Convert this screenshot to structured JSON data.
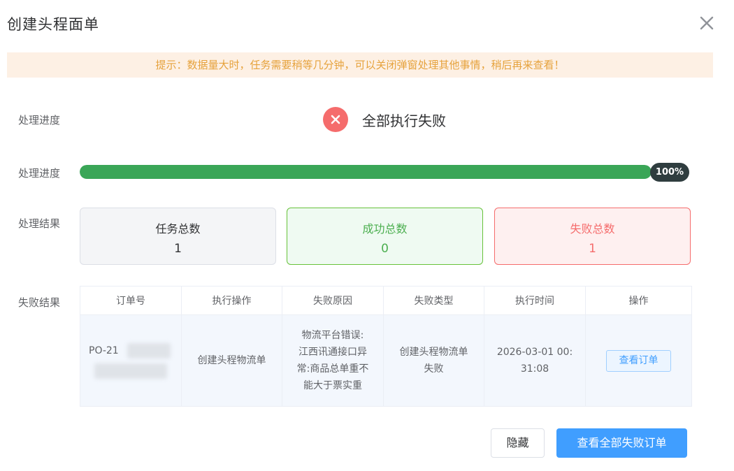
{
  "dialog": {
    "title": "创建头程面单",
    "close_icon": "close-icon"
  },
  "tip": {
    "text": "提示：数据量大时，任务需要稍等几分钟，可以关闭弹窗处理其他事情，稍后再来查看！"
  },
  "status_row": {
    "label": "处理进度",
    "icon": "error-circle-icon",
    "icon_color": "#f56c6c",
    "text": "全部执行失败"
  },
  "progress_row": {
    "label": "处理进度",
    "percent": 100,
    "percent_text": "100%",
    "bar_color": "#3aa657"
  },
  "result_row": {
    "label": "处理结果",
    "cards": [
      {
        "label": "任务总数",
        "value": "1"
      },
      {
        "label": "成功总数",
        "value": "0"
      },
      {
        "label": "失败总数",
        "value": "1"
      }
    ]
  },
  "fail_row": {
    "label": "失败结果",
    "columns": [
      "订单号",
      "执行操作",
      "失败原因",
      "失败类型",
      "执行时间",
      "操作"
    ],
    "rows": [
      {
        "order_no_visible": "PO-21",
        "operation": "创建头程物流单",
        "reason_lines": [
          "物流平台错误:",
          "江西讯通接口异",
          "常:商品总单重不",
          "能大于票实重"
        ],
        "type_lines": [
          "创建头程物流单",
          "失败"
        ],
        "time_lines": [
          "2026-03-01 00:",
          "31:08"
        ],
        "action_label": "查看订单"
      }
    ]
  },
  "footer": {
    "hide_label": "隐藏",
    "view_all_label": "查看全部失败订单"
  },
  "colors": {
    "primary": "#409eff",
    "success": "#67c23a",
    "danger": "#f56c6c",
    "warning": "#e6a23c"
  }
}
